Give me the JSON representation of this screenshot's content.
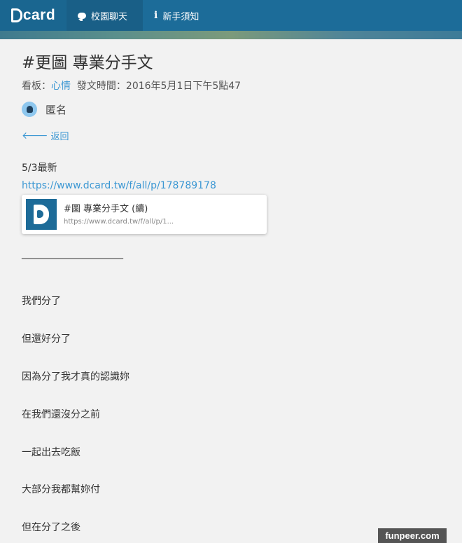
{
  "nav": {
    "logo_text": "card",
    "chat_label": "校園聊天",
    "guide_label": "新手須知",
    "colors": {
      "bar": "#1c6c99",
      "active": "#195f87"
    }
  },
  "post": {
    "title": "#更圖 專業分手文",
    "board_prefix": "看板：",
    "board_name": "心情",
    "time_label": "發文時間：2016年5月1日下午5點47",
    "author": "匿名",
    "back_label": "返回",
    "update_note": "5/3最新",
    "link": "https://www.dcard.tw/f/all/p/178789178",
    "preview": {
      "title": "#圖 專業分手文 (續)",
      "url": "https://www.dcard.tw/f/all/p/1..."
    },
    "divider": "________________________",
    "lines": [
      "我們分了",
      "但還好分了",
      "因為分了我才真的認識妳",
      "在我們還沒分之前",
      "一起出去吃飯",
      "大部分我都幫妳付",
      "但在分了之後"
    ],
    "link_color": "#3b97d3"
  },
  "watermark": "funpeer.com"
}
